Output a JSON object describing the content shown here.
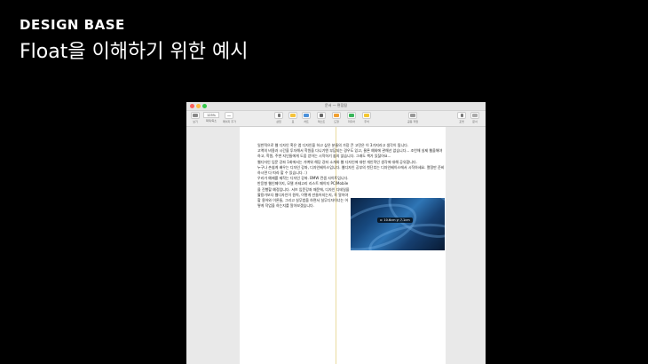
{
  "slide": {
    "brand": "DESIGN BASE",
    "headline": "Float을 이해하기 위한 예시"
  },
  "window": {
    "doc_title": "문서 — 편집됨"
  },
  "toolbar": {
    "view": "보기",
    "zoom_value": "125%",
    "zoom": "확대/축소",
    "add_page": "페이지 추가",
    "insert": "삽입",
    "table": "표",
    "chart": "차트",
    "text": "텍스트",
    "shape": "도형",
    "media": "미디어",
    "comment": "주석",
    "share": "공동 작업",
    "format": "포맷",
    "document": "문서"
  },
  "document": {
    "paragraphs": [
      "일반적으로 웹 디자인 혹은 앱 디자인을 하고 싶은 분들의 가장 큰 고민은 이 3가지라고 생각이 됩니다.",
      "고액의 비용과 시간을 투자해서 학원을 다니기엔 부담되는 경우도 있고, 물론 예외에 관해선 없습니다... 조언해 실제 웹을해야 하고, 학원, 주변 지인들에게 도움 얻어는 시작하기 쉽지 않습니다. 그래도 책가 있잖아요...",
      "웹디자인 입문 강좌 1회에서는 가벼워 해당 강좌 소개와 웹 디자인에 대한 개인적인 생각에 대해 공유합니다.",
      "누구나 손쉽게 배우는 디자인 강좌, 디자인베이스입니다. 웹디자인 공부의 첫단추는 디자인베이스에서 시작하세요. 열정만 준비하시면 다 따라 할 수 있습니다. :)"
    ],
    "float_paragraph": "우리가 예제를 제작는 디자인 강좌. BMW 컨셉 사이트입니다. 반응형 웹인페이지, 모델 카테고리 리스트 페이지 PC/Mobile을 진행할 예정입니다. 서브 입문강좌 때문에, 디자인 디테일을 활용가보다 웹디자인이 원칙, 이렇게 만들어지는지, 꼭 알아야할 용어와 이론들, 그리고 실무법을 하면서 실무디자이너는 어떻게 작업을 하는지를 알아보겠습니다.",
    "photo_tip": "x: 10.6cm y: 7.1cm"
  },
  "colors": {
    "background": "#000000",
    "traffic_red": "#fc605c",
    "traffic_yellow": "#fdbc40",
    "traffic_green": "#34c84a"
  }
}
